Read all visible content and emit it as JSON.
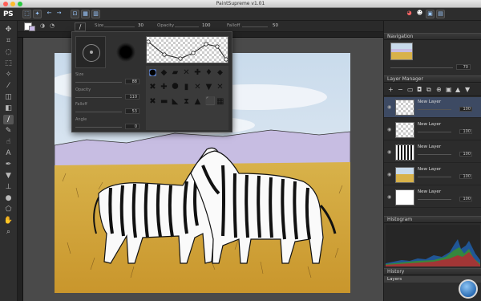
{
  "window": {
    "title": "PaintSupreme v1.01"
  },
  "app": {
    "logo": "PS"
  },
  "toolbar": {
    "buttons": [
      "select-icon",
      "magic-icon",
      "undo-icon",
      "redo-icon",
      "fit-icon",
      "grid-icon",
      "windows-icon"
    ],
    "right_buttons": [
      "color-icon",
      "fx-icon",
      "image-icon",
      "layers-icon"
    ]
  },
  "options": {
    "size_label": "Size",
    "size_value": "30",
    "opacity_label": "Opacity",
    "opacity_value": "100",
    "falloff_label": "Falloff",
    "falloff_value": "50"
  },
  "tools": [
    "move-icon",
    "crop-icon",
    "lasso-icon",
    "select-icon",
    "magic-wand-icon",
    "eyedropper-icon",
    "eraser-icon",
    "gradient-icon",
    "brush-icon",
    "pencil-icon",
    "smudge-icon",
    "text-icon",
    "pen-icon",
    "fill-icon",
    "stamp-icon",
    "dodge-icon",
    "shape-icon",
    "hand-icon",
    "zoom-icon"
  ],
  "brush_popup": {
    "size_label": "Size",
    "size_value": "88",
    "opacity_label": "Opacity",
    "opacity_value": "110",
    "falloff_label": "Falloff",
    "falloff_value": "53",
    "angle_label": "Angle",
    "angle_value": "0",
    "shapes": [
      "●",
      "◆",
      "▰",
      "✕",
      "✚",
      "♦",
      "⬥",
      "✖",
      "✚",
      "⯃",
      "▮",
      "✕",
      "▼",
      "✕",
      "✖",
      "▬",
      "◣",
      "⧗",
      "▲",
      "⬛",
      "▦"
    ]
  },
  "navigation": {
    "title": "Navigation",
    "zoom": "70"
  },
  "layers": {
    "title": "Layer Manager",
    "items": [
      {
        "name": "New Layer",
        "opacity": "100",
        "active": true
      },
      {
        "name": "New Layer",
        "opacity": "100",
        "active": false
      },
      {
        "name": "New Layer",
        "opacity": "100",
        "active": false
      },
      {
        "name": "New Layer",
        "opacity": "100",
        "active": false
      },
      {
        "name": "New Layer",
        "opacity": "100",
        "active": false
      }
    ]
  },
  "histogram": {
    "title": "Histogram"
  },
  "history": {
    "title": "History",
    "items": [
      "Layers"
    ]
  }
}
